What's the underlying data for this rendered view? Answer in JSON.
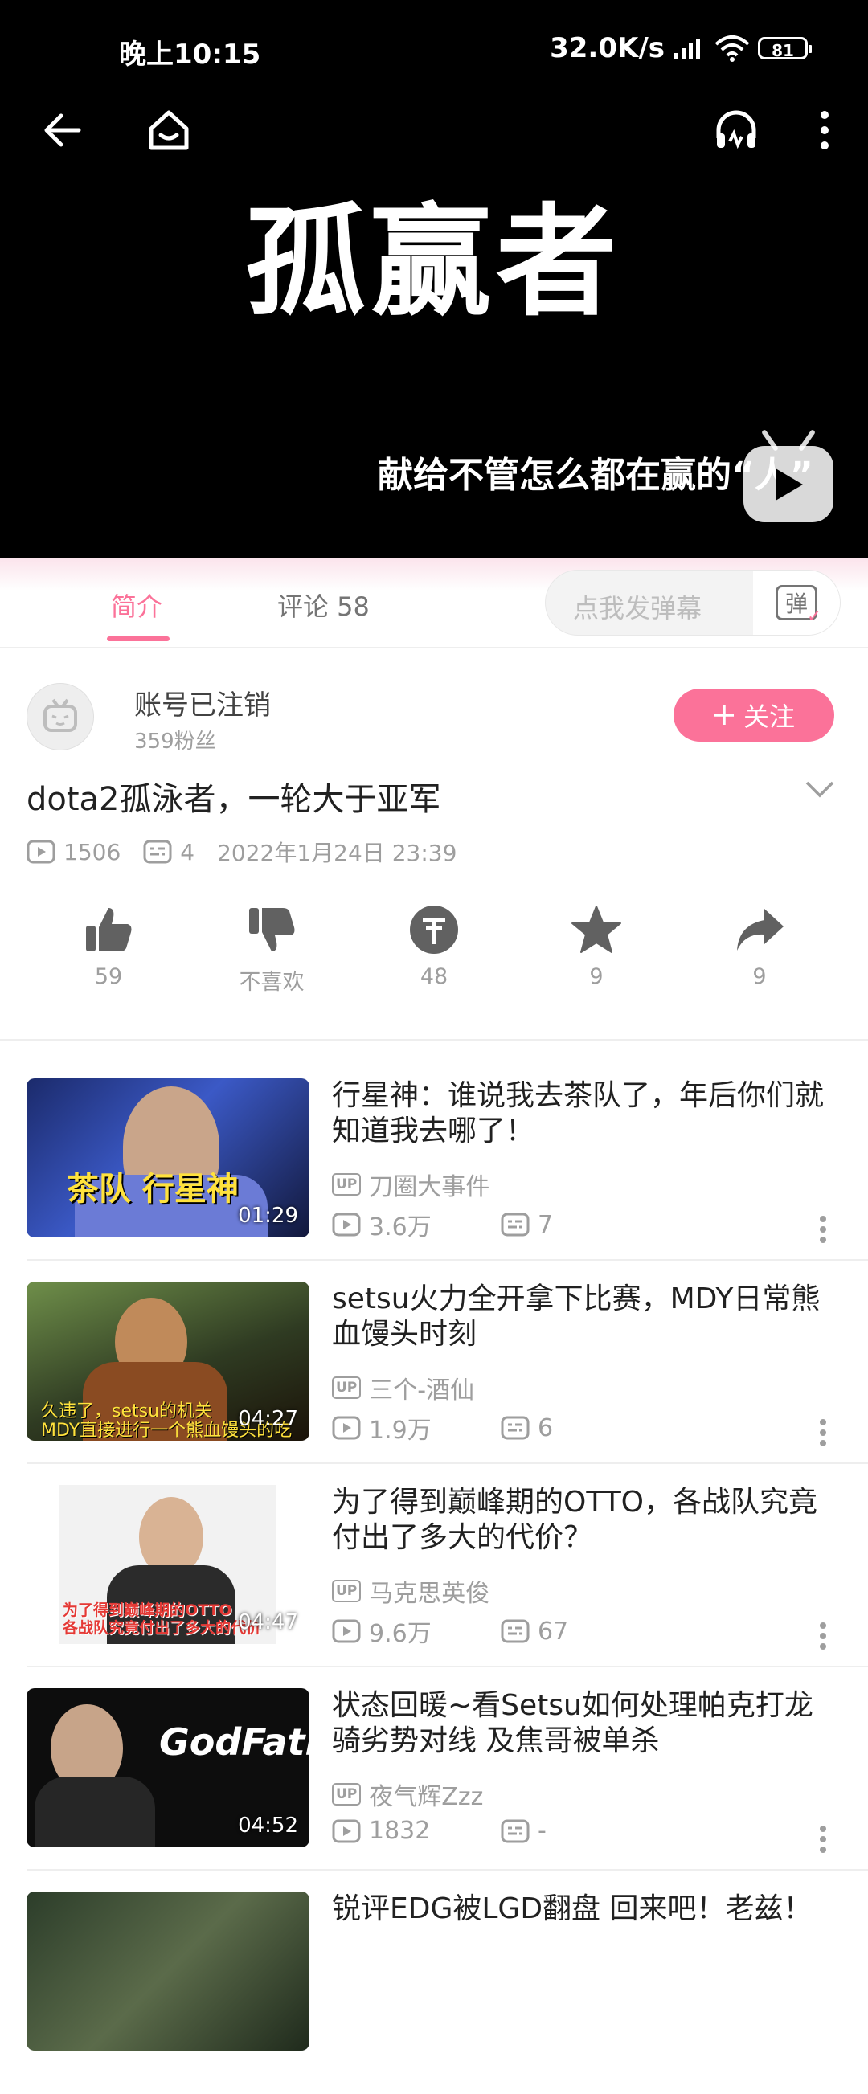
{
  "status_bar": {
    "time": "晚上10:15",
    "net_speed": "32.0K/s",
    "battery": "81"
  },
  "video": {
    "overlay_title": "孤赢者",
    "overlay_caption": "献给不管怎么都在赢的“人”"
  },
  "tabs": {
    "intro": "简介",
    "comments": "评论 58",
    "danmaku_placeholder": "点我发弹幕",
    "danmaku_icon_text": "弹"
  },
  "uploader": {
    "name": "账号已注销",
    "fans": "359粉丝",
    "follow_label": "关注"
  },
  "video_info": {
    "title": "dota2孤泳者，一轮大于亚军",
    "views": "1506",
    "danmaku_count": "4",
    "date": "2022年1月24日 23:39"
  },
  "actions": {
    "like": "59",
    "dislike": "不喜欢",
    "coin": "48",
    "favorite": "9",
    "share": "9"
  },
  "recommendations": [
    {
      "title": "行星神：谁说我去茶队了，年后你们就知道我去哪了！",
      "up": "刀圈大事件",
      "views": "3.6万",
      "danmaku": "7",
      "duration": "01:29",
      "thumb_text": "茶队 行星神"
    },
    {
      "title": "setsu火力全开拿下比赛，MDY日常熊血馒头时刻",
      "up": "三个-酒仙",
      "views": "1.9万",
      "danmaku": "6",
      "duration": "04:27",
      "thumb_text": "久违了，setsu的机关\nMDY直接进行一个熊血馒头的吃"
    },
    {
      "title": "为了得到巅峰期的OTTO，各战队究竟付出了多大的代价？",
      "up": "马克思英俊",
      "views": "9.6万",
      "danmaku": "67",
      "duration": "04:47",
      "thumb_text": "为了得到巅峰期的OTTO\n各战队究竟付出了多大的代价"
    },
    {
      "title": "状态回暖~看Setsu如何处理帕克打龙骑劣势对线 及焦哥被单杀",
      "up": "夜气辉Zzz",
      "views": "1832",
      "danmaku": "-",
      "duration": "04:52",
      "thumb_text": "GodFather"
    },
    {
      "title": "锐评EDG被LGD翻盘 回来吧！老兹！",
      "up": "",
      "views": "",
      "danmaku": "",
      "duration": "",
      "thumb_text": ""
    }
  ],
  "up_badge": "UP"
}
